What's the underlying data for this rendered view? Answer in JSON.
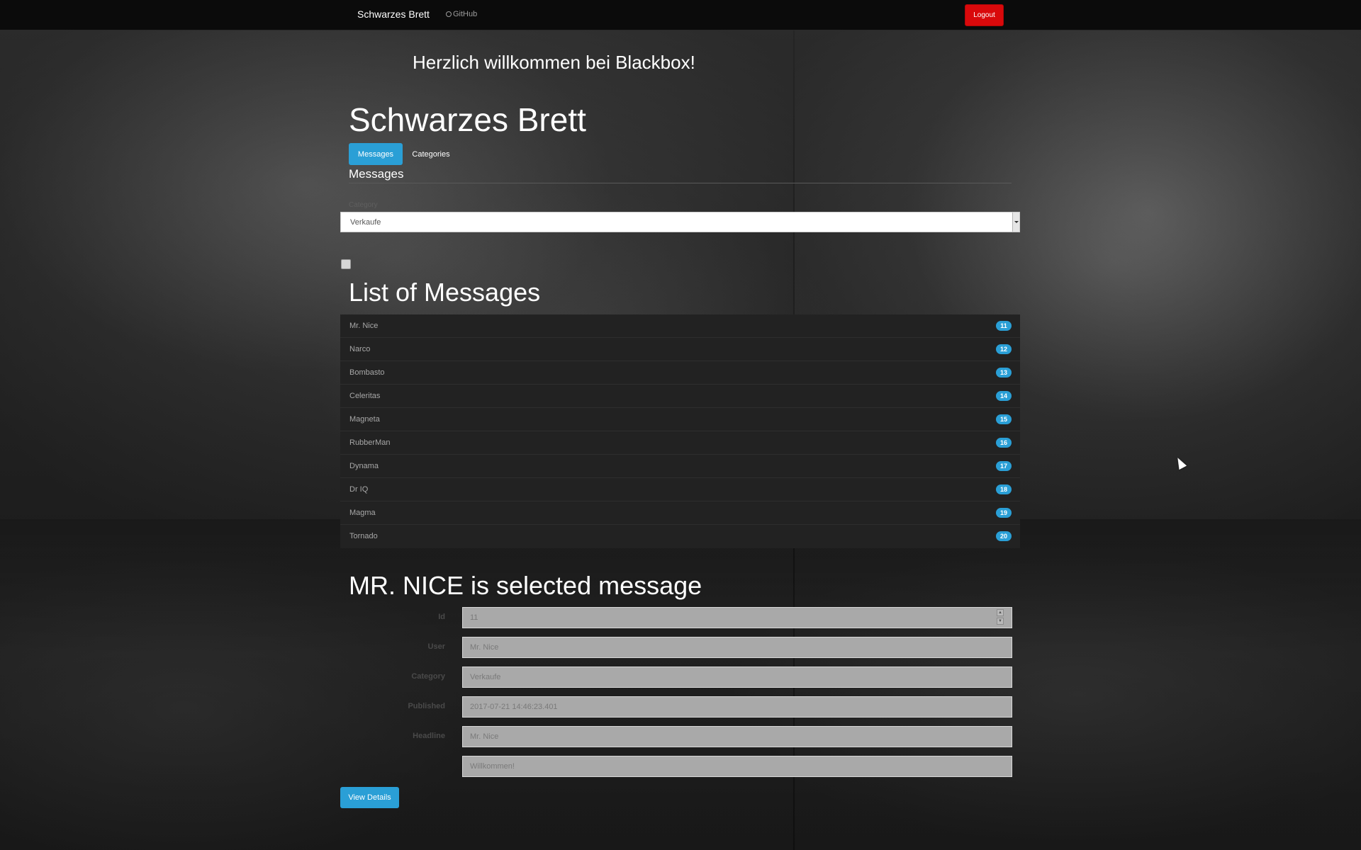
{
  "navbar": {
    "brand": "Schwarzes Brett",
    "github_label": "GitHub",
    "logout_label": "Logout"
  },
  "welcome": "Herzlich willkommen bei Blackbox!",
  "app_title": "Schwarzes Brett",
  "tabs": [
    {
      "label": "Messages",
      "active": true
    },
    {
      "label": "Categories",
      "active": false
    }
  ],
  "section_title": "Messages",
  "category_filter": {
    "label": "Category",
    "selected": "Verkaufe"
  },
  "list_title": "List of Messages",
  "messages": [
    {
      "name": "Mr. Nice",
      "id": "11"
    },
    {
      "name": "Narco",
      "id": "12"
    },
    {
      "name": "Bombasto",
      "id": "13"
    },
    {
      "name": "Celeritas",
      "id": "14"
    },
    {
      "name": "Magneta",
      "id": "15"
    },
    {
      "name": "RubberMan",
      "id": "16"
    },
    {
      "name": "Dynama",
      "id": "17"
    },
    {
      "name": "Dr IQ",
      "id": "18"
    },
    {
      "name": "Magma",
      "id": "19"
    },
    {
      "name": "Tornado",
      "id": "20"
    }
  ],
  "selected": {
    "title": "MR. NICE is selected message",
    "fields": {
      "id": {
        "label": "Id",
        "value": "11"
      },
      "user": {
        "label": "User",
        "value": "Mr. Nice"
      },
      "category": {
        "label": "Category",
        "value": "Verkaufe"
      },
      "published": {
        "label": "Published",
        "value": "2017-07-21 14:46:23.401"
      },
      "headline": {
        "label": "Headline",
        "value": "Mr. Nice"
      },
      "message": {
        "label": "",
        "value": "Willkommen!"
      }
    },
    "details_button": "View Details"
  },
  "colors": {
    "accent": "#2a9fd6",
    "logout": "#d9090b",
    "navbar": "#0b0b0b",
    "list_bg": "#222222"
  }
}
